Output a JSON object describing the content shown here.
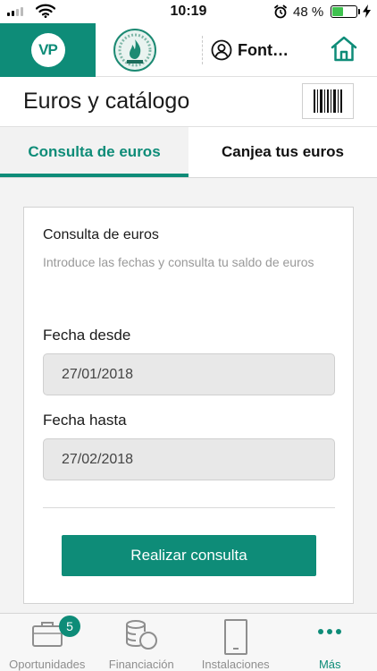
{
  "status_bar": {
    "time": "10:19",
    "battery_percent": "48 %",
    "battery_level": 0.48
  },
  "header": {
    "logo_text": "VP",
    "user_name": "Font…"
  },
  "page": {
    "title": "Euros y catálogo"
  },
  "tabs": [
    {
      "label": "Consulta de euros",
      "active": true
    },
    {
      "label": "Canjea tus euros",
      "active": false
    }
  ],
  "form": {
    "title": "Consulta de euros",
    "description": "Introduce las fechas y consulta tu saldo de euros",
    "from_label": "Fecha desde",
    "from_value": "27/01/2018",
    "to_label": "Fecha hasta",
    "to_value": "27/02/2018",
    "submit_label": "Realizar consulta"
  },
  "bottom_nav": {
    "items": [
      {
        "label": "Oportunidades",
        "icon": "briefcase-icon",
        "badge": "5"
      },
      {
        "label": "Financiación",
        "icon": "coins-icon"
      },
      {
        "label": "Instalaciones",
        "icon": "door-icon"
      },
      {
        "label": "Más",
        "icon": "more-dots-icon",
        "active": true
      }
    ]
  },
  "colors": {
    "accent": "#0e8c78",
    "battery": "#3fc24f"
  }
}
